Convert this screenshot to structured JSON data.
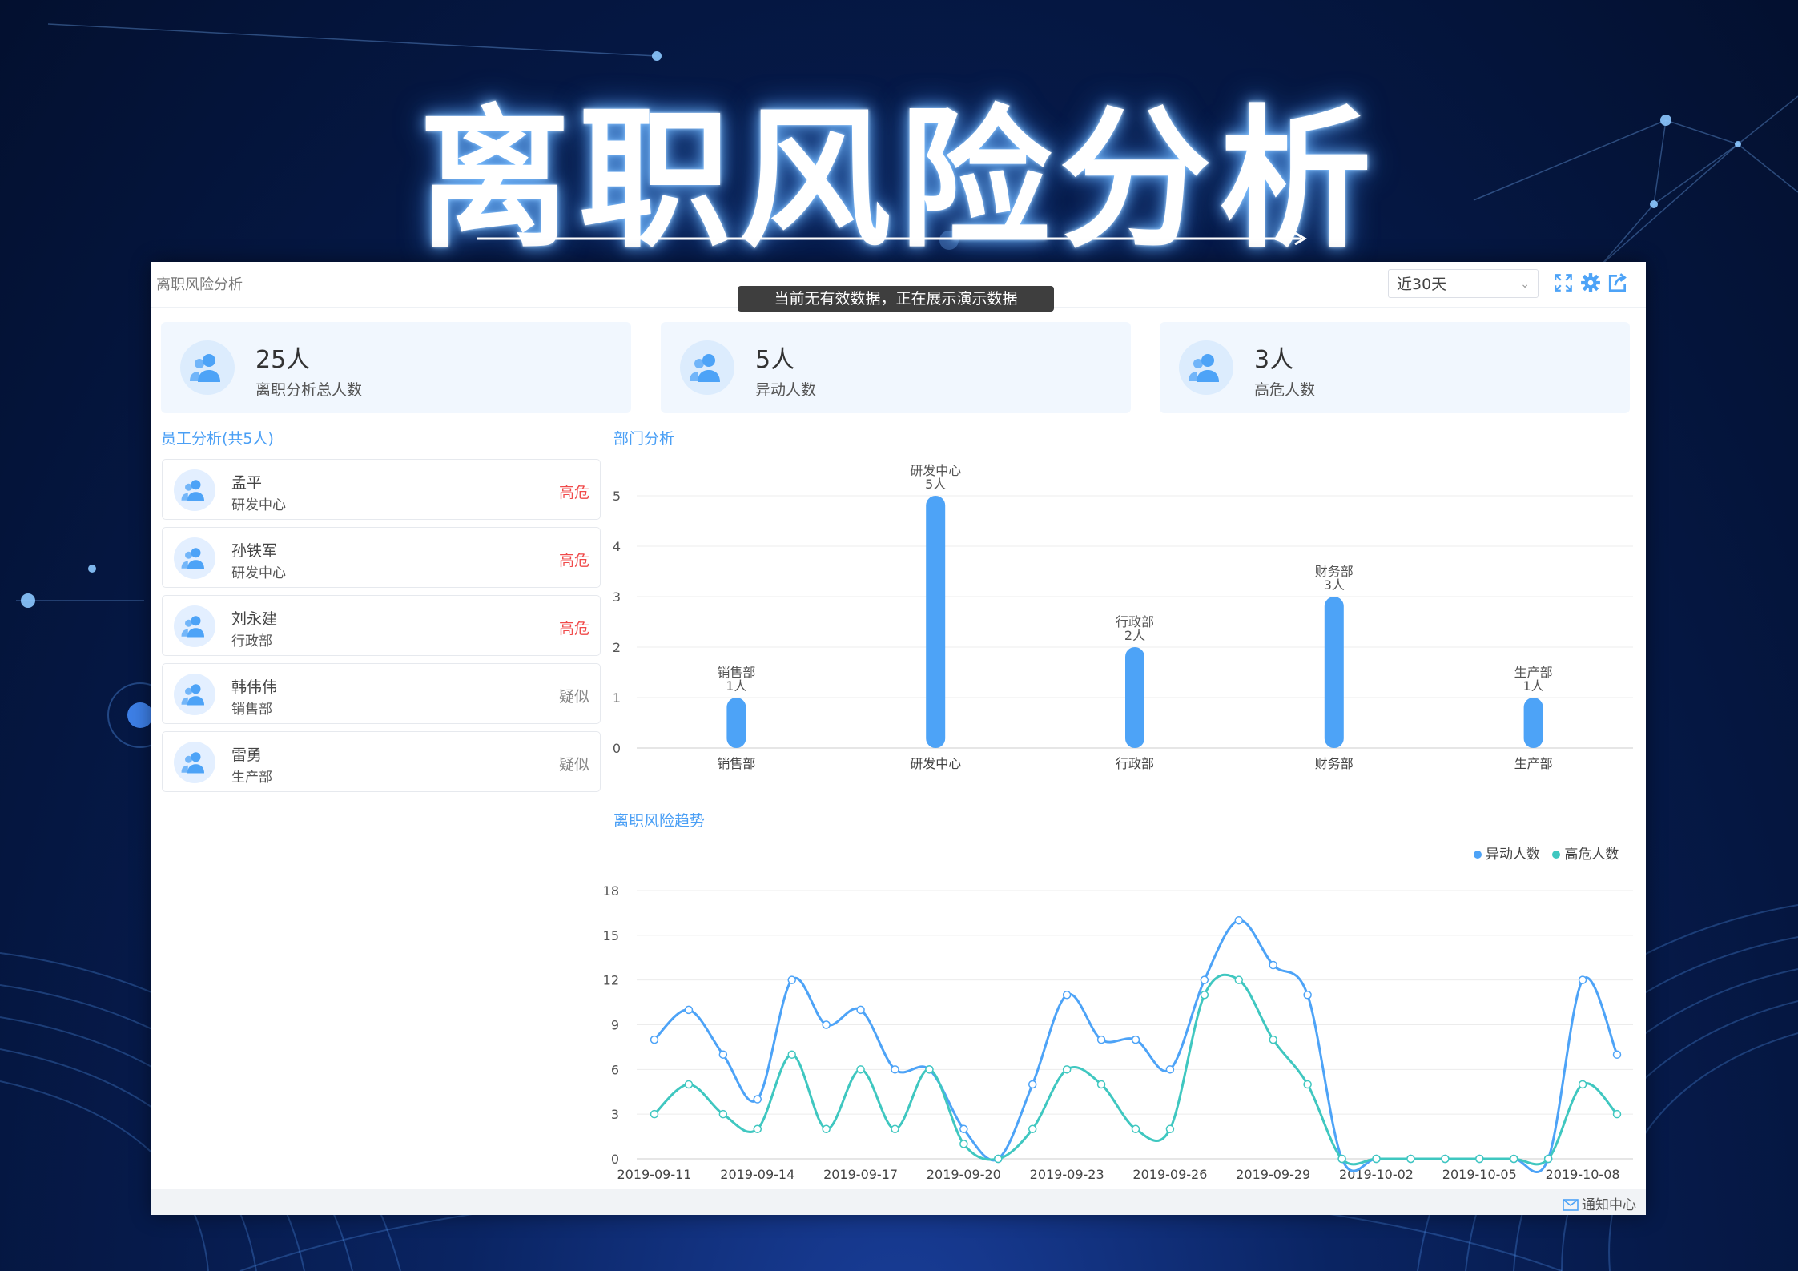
{
  "hero": {
    "title": "离职风险分析"
  },
  "window": {
    "app_title": "离职风险分析",
    "toast": "当前无有效数据，正在展示演示数据",
    "range_select": "近30天",
    "footer_notify": "通知中心"
  },
  "kpis": [
    {
      "value": "25人",
      "label": "离职分析总人数"
    },
    {
      "value": "5人",
      "label": "异动人数"
    },
    {
      "value": "3人",
      "label": "高危人数"
    }
  ],
  "sections": {
    "employee_title": "员工分析(共5人)",
    "dept_title": "部门分析",
    "trend_title": "离职风险趋势"
  },
  "employees": [
    {
      "name": "孟平",
      "dept": "研发中心",
      "risk": "高危"
    },
    {
      "name": "孙铁军",
      "dept": "研发中心",
      "risk": "高危"
    },
    {
      "name": "刘永建",
      "dept": "行政部",
      "risk": "高危"
    },
    {
      "name": "韩伟伟",
      "dept": "销售部",
      "risk": "疑似"
    },
    {
      "name": "雷勇",
      "dept": "生产部",
      "risk": "疑似"
    }
  ],
  "colors": {
    "primary": "#4da3f7",
    "secondary": "#3fc7c0",
    "danger": "#f04a4a",
    "muted": "#888888"
  },
  "chart_data": [
    {
      "type": "bar",
      "categories": [
        "销售部",
        "研发中心",
        "行政部",
        "财务部",
        "生产部"
      ],
      "values": [
        1,
        5,
        2,
        3,
        1
      ],
      "data_labels": [
        "1人",
        "5人",
        "2人",
        "3人",
        "1人"
      ],
      "ylim": [
        0,
        5
      ],
      "yticks": [
        0,
        1,
        2,
        3,
        4,
        5
      ],
      "grid": true
    },
    {
      "type": "line",
      "x": [
        "2019-09-11",
        "2019-09-12",
        "2019-09-13",
        "2019-09-14",
        "2019-09-15",
        "2019-09-16",
        "2019-09-17",
        "2019-09-18",
        "2019-09-19",
        "2019-09-20",
        "2019-09-21",
        "2019-09-22",
        "2019-09-23",
        "2019-09-24",
        "2019-09-25",
        "2019-09-26",
        "2019-09-27",
        "2019-09-28",
        "2019-09-29",
        "2019-09-30",
        "2019-10-01",
        "2019-10-02",
        "2019-10-03",
        "2019-10-04",
        "2019-10-05",
        "2019-10-06",
        "2019-10-07",
        "2019-10-08",
        "2019-10-09"
      ],
      "xticks": [
        "2019-09-11",
        "2019-09-14",
        "2019-09-17",
        "2019-09-20",
        "2019-09-23",
        "2019-09-26",
        "2019-09-29",
        "2019-10-02",
        "2019-10-05",
        "2019-10-08"
      ],
      "series": [
        {
          "name": "异动人数",
          "values": [
            8,
            10,
            7,
            4,
            12,
            9,
            10,
            6,
            6,
            2,
            0,
            5,
            11,
            8,
            8,
            6,
            12,
            16,
            13,
            11,
            0,
            0,
            0,
            0,
            0,
            0,
            0,
            12,
            7
          ]
        },
        {
          "name": "高危人数",
          "values": [
            3,
            5,
            3,
            2,
            7,
            2,
            6,
            2,
            6,
            1,
            0,
            2,
            6,
            5,
            2,
            2,
            11,
            12,
            8,
            5,
            0,
            0,
            0,
            0,
            0,
            0,
            0,
            5,
            3
          ]
        }
      ],
      "ylim": [
        0,
        18
      ],
      "yticks": [
        0,
        3,
        6,
        9,
        12,
        15,
        18
      ],
      "legend": "top-right",
      "grid": true
    }
  ]
}
